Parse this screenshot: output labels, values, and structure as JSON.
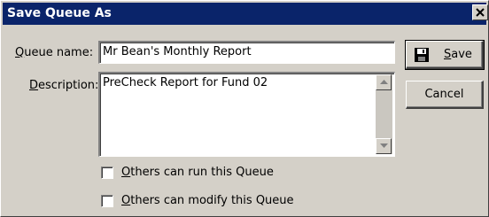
{
  "window": {
    "title": "Save Queue As",
    "close_icon": "close-icon"
  },
  "form": {
    "queue_name_label": "Queue name:",
    "queue_name_value": "Mr Bean's Monthly Report",
    "description_label": "Description:",
    "description_value": "PreCheck Report for Fund 02"
  },
  "options": [
    {
      "label": "Others can run this Queue",
      "checked": false
    },
    {
      "label": "Others can modify this Queue",
      "checked": false
    }
  ],
  "buttons": {
    "save_label": "Save",
    "save_icon": "floppy-disk-icon",
    "cancel_label": "Cancel"
  },
  "colors": {
    "titlebar": "#0a246a",
    "dialog_face": "#d4d0c8"
  }
}
